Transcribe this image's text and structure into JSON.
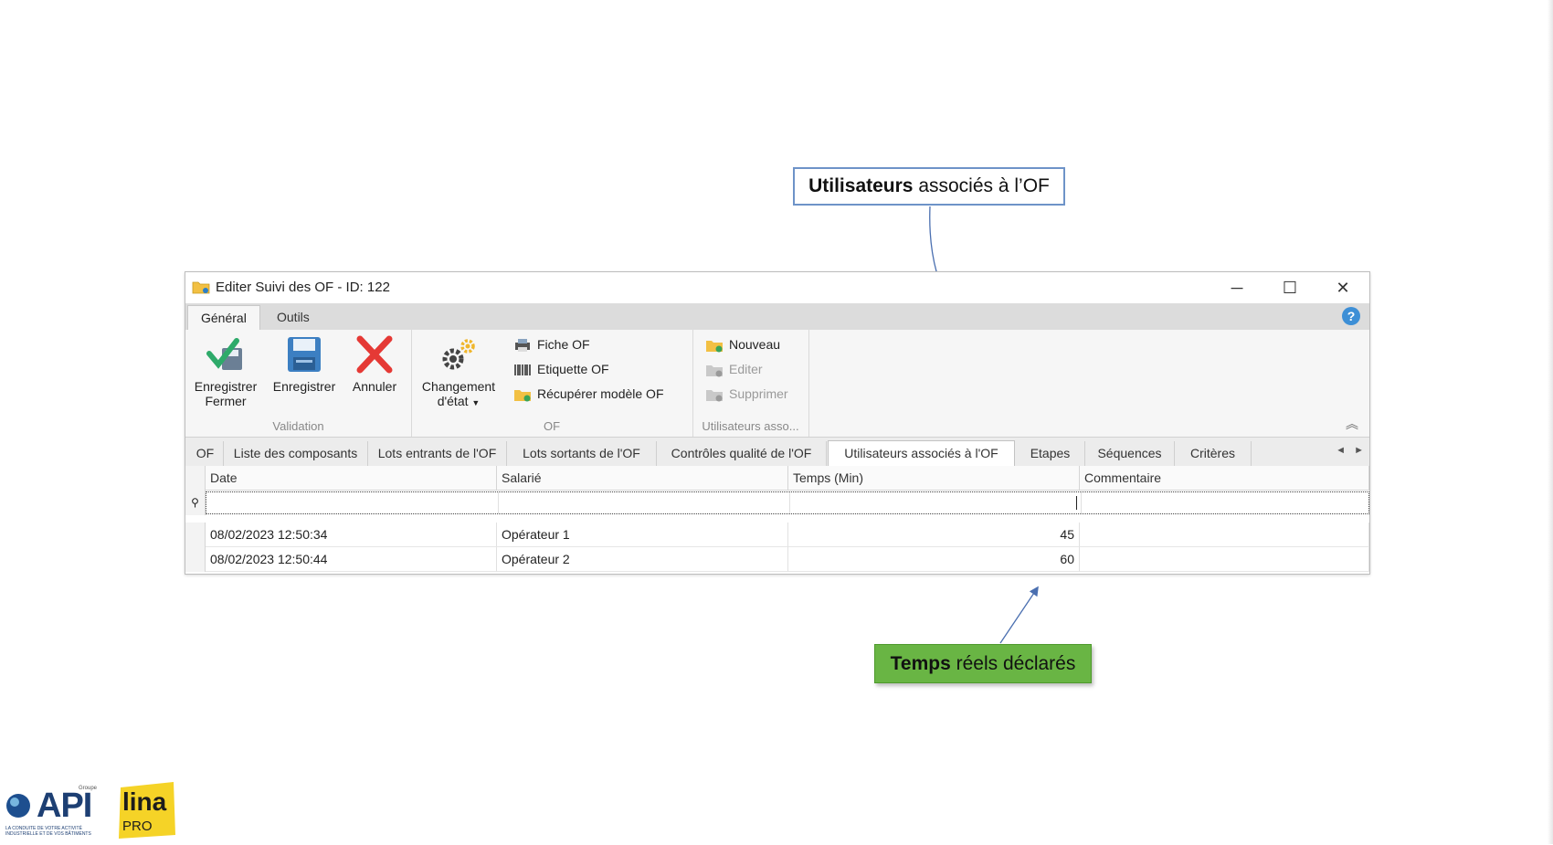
{
  "callouts": {
    "users_bold": "Utilisateurs",
    "users_rest": " associés à l’OF",
    "time_bold": "Temps",
    "time_rest": " réels déclarés"
  },
  "window": {
    "title": "Editer Suivi des OF - ID: 122",
    "minimize": "─",
    "maximize": "☐",
    "close": "✕"
  },
  "ribbon": {
    "tabs": [
      {
        "label": "Général",
        "active": true
      },
      {
        "label": "Outils",
        "active": false
      }
    ],
    "help": "?",
    "groups": {
      "validation": {
        "label": "Validation",
        "save_close": "Enregistrer",
        "save_close_2": "Fermer",
        "save": "Enregistrer",
        "cancel": "Annuler"
      },
      "of": {
        "label": "OF",
        "change_state": "Changement",
        "change_state_2": "d'état",
        "fiche": "Fiche OF",
        "etiquette": "Etiquette OF",
        "recuperer": "Récupérer modèle OF"
      },
      "users": {
        "label": "Utilisateurs asso...",
        "nouveau": "Nouveau",
        "editer": "Editer",
        "supprimer": "Supprimer"
      }
    },
    "collapse": "︽"
  },
  "doc_tabs": [
    {
      "label": "OF"
    },
    {
      "label": "Liste des composants"
    },
    {
      "label": "Lots entrants de l'OF"
    },
    {
      "label": "Lots sortants de l'OF"
    },
    {
      "label": "Contrôles qualité de l'OF"
    },
    {
      "label": "Utilisateurs associés à l'OF",
      "active": true
    },
    {
      "label": "Etapes"
    },
    {
      "label": "Séquences"
    },
    {
      "label": "Critères"
    }
  ],
  "tab_nav": {
    "prev": "◄",
    "next": "►"
  },
  "grid": {
    "columns": [
      "Date",
      "Salarié",
      "Temps (Min)",
      "Commentaire"
    ],
    "filter_icon": "⚲",
    "rows": [
      {
        "date": "08/02/2023 12:50:34",
        "salarie": "Opérateur 1",
        "temps": "45",
        "commentaire": ""
      },
      {
        "date": "08/02/2023 12:50:44",
        "salarie": "Opérateur 2",
        "temps": "60",
        "commentaire": ""
      }
    ]
  },
  "logos": {
    "api": "API",
    "api_tagline": "LA CONDUITE DE VOTRE ACTIVITÉ INDUSTRIELLE ET DE VOS BÂTIMENTS",
    "api_groupe": "Groupe",
    "lina": "lina",
    "lina_pro": "PRO"
  },
  "colors": {
    "callout_blue_border": "#6e93c8",
    "callout_green": "#69b544",
    "accent_blue": "#3d8fd6",
    "cancel_red": "#e53935",
    "check_green": "#2eaa6a"
  }
}
